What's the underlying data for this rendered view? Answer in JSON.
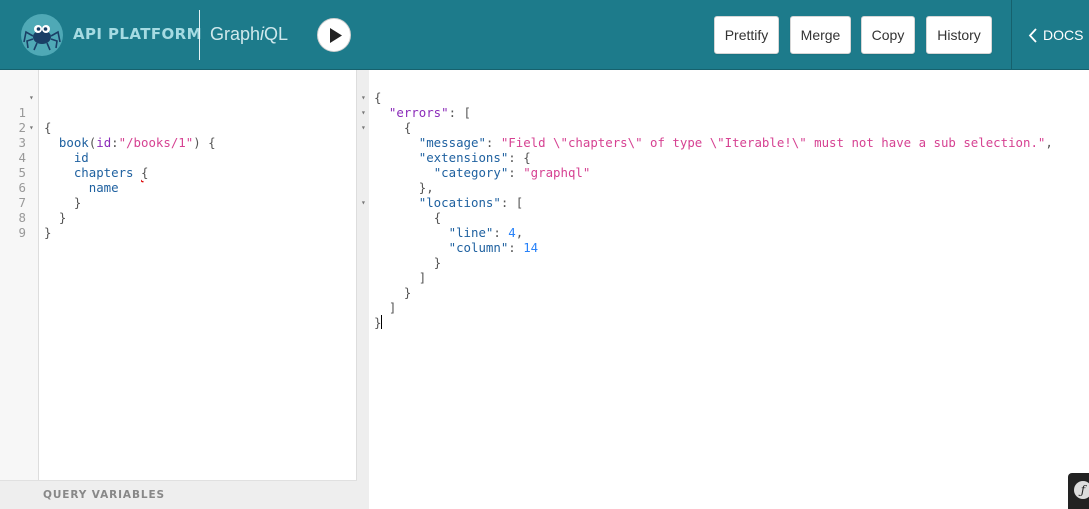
{
  "header": {
    "brand": "API PLATFORM",
    "app_title_a": "Graph",
    "app_title_b": "i",
    "app_title_c": "QL",
    "buttons": {
      "prettify": "Prettify",
      "merge": "Merge",
      "copy": "Copy",
      "history": "History"
    },
    "docs_label": "DOCS"
  },
  "query_editor": {
    "line_numbers": [
      "1",
      "2",
      "3",
      "4",
      "5",
      "6",
      "7",
      "8",
      "9"
    ],
    "l1": "{",
    "l2_field": "book",
    "l2_p1": "(",
    "l2_arg": "id",
    "l2_colon": ":",
    "l2_value": "\"/books/1\"",
    "l2_p2": ") {",
    "l3": "id",
    "l4_field": "chapters",
    "l4_brace": "{",
    "l5": "name",
    "l6": "}",
    "l7": "}",
    "l8": "}"
  },
  "query_variables_label": "QUERY VARIABLES",
  "result": {
    "open": "{",
    "errors_key": "\"errors\"",
    "errors_open": ": [",
    "obj_open": "{",
    "message_key": "\"message\"",
    "message_value": "\"Field \\\"chapters\\\" of type \\\"Iterable!\\\" must not have a sub selection.\"",
    "extensions_key": "\"extensions\"",
    "ext_open": ": {",
    "category_key": "\"category\"",
    "category_value": "\"graphql\"",
    "ext_close": "},",
    "locations_key": "\"locations\"",
    "loc_open": ": [",
    "loc_obj_open": "{",
    "line_key": "\"line\"",
    "line_value": "4",
    "column_key": "\"column\"",
    "column_value": "14",
    "loc_obj_close": "}",
    "loc_close": "]",
    "obj_close": "}",
    "errors_close": "]",
    "close": "}"
  },
  "colors": {
    "header_bg": "#1d7b8b",
    "property": "#1f61a0",
    "string": "#d64292",
    "number": "#2882f9",
    "argument": "#8b2bb9"
  },
  "icons": {
    "logo": "spider-logo-icon",
    "run": "play-icon",
    "docs": "chevron-left-icon",
    "badge": "symfony-icon"
  }
}
